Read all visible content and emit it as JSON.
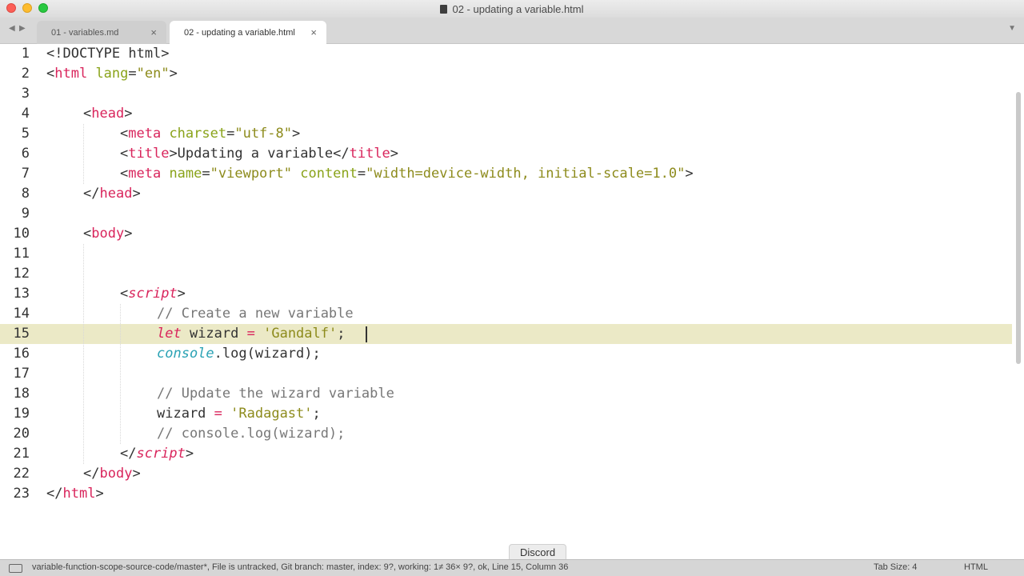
{
  "window": {
    "title": "02 - updating a variable.html"
  },
  "tabs": [
    {
      "label": "01 - variables.md",
      "active": false
    },
    {
      "label": "02 - updating a variable.html",
      "active": true
    }
  ],
  "icons": {
    "nav_back": "◀",
    "nav_forward": "▶",
    "close": "×",
    "dropdown": "▼"
  },
  "editor": {
    "line_numbers": [
      "1",
      "2",
      "3",
      "4",
      "5",
      "6",
      "7",
      "8",
      "9",
      "10",
      "11",
      "12",
      "13",
      "14",
      "15",
      "16",
      "17",
      "18",
      "19",
      "20",
      "21",
      "22",
      "23"
    ],
    "current_line": "15",
    "tokens": {
      "l1_a": "<!DOCTYPE html>",
      "l2_a": "<",
      "l2_b": "html",
      "l2_c": " lang",
      "l2_d": "=",
      "l2_e": "\"en\"",
      "l2_f": ">",
      "l4_a": "<",
      "l4_b": "head",
      "l4_c": ">",
      "l5_a": "<",
      "l5_b": "meta",
      "l5_c": " charset",
      "l5_d": "=",
      "l5_e": "\"utf-8\"",
      "l5_f": ">",
      "l6_a": "<",
      "l6_b": "title",
      "l6_c": ">Updating a variable</",
      "l6_d": "title",
      "l6_e": ">",
      "l7_a": "<",
      "l7_b": "meta",
      "l7_c": " name",
      "l7_d": "=",
      "l7_e": "\"viewport\"",
      "l7_f": " content",
      "l7_g": "=",
      "l7_h": "\"width=device-width, initial-scale=1.0\"",
      "l7_i": ">",
      "l8_a": "</",
      "l8_b": "head",
      "l8_c": ">",
      "l10_a": "<",
      "l10_b": "body",
      "l10_c": ">",
      "l13_a": "<",
      "l13_b": "script",
      "l13_c": ">",
      "l14_a": "// Create a new variable",
      "l15_a": "let",
      "l15_b": " wizard ",
      "l15_c": "=",
      "l15_d": " ",
      "l15_e": "'Gandalf'",
      "l15_f": ";",
      "l16_a": "console",
      "l16_b": ".log(wizard);",
      "l18_a": "// Update the wizard variable",
      "l19_a": "wizard ",
      "l19_b": "=",
      "l19_c": " ",
      "l19_d": "'Radagast'",
      "l19_e": ";",
      "l20_a": "// console.log(wizard);",
      "l21_a": "</",
      "l21_b": "script",
      "l21_c": ">",
      "l22_a": "</",
      "l22_b": "body",
      "l22_c": ">",
      "l23_a": "</",
      "l23_b": "html",
      "l23_c": ">"
    }
  },
  "tooltip": {
    "text": "Discord"
  },
  "status": {
    "text": "variable-function-scope-source-code/master*, File is untracked, Git branch: master, index: 9?, working: 1≠ 36× 9?, ok, Line 15, Column 36",
    "tab_size": "Tab Size: 4",
    "syntax": "HTML"
  },
  "colors": {
    "tag": "#d9255c",
    "attribute": "#8aa31a",
    "string": "#8d8b1c",
    "comment": "#777777",
    "function": "#2aa2b4",
    "line_highlight": "#ebe9c6"
  }
}
